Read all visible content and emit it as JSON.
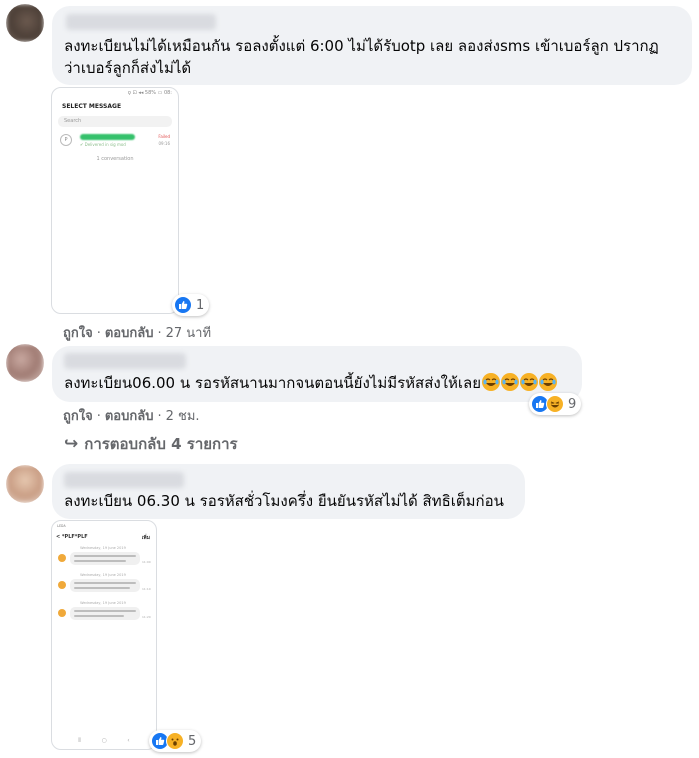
{
  "comments": [
    {
      "text_line1": "ลงทะเบียนไม่ได้เหมือนกัน รอลงตั้งแต่ 6:00 ไม่ได้รับotp เลย ลองส่งsms เข้าเบอร์ลูก ปรากฏ",
      "text_line2": "ว่าเบอร์ลูกก็ส่งไม่ได้",
      "screenshot": {
        "status_bar": "ǫ ⊡ ◂◂ 58% ▭ 08:",
        "title": "SELECT MESSAGE",
        "search_placeholder": "Search",
        "avatar_letter": "P",
        "failed_label": "Failed",
        "time": "09:16",
        "status_line": "✔ Delivered in sig mod",
        "conversation_count": "1 conversation"
      },
      "reactions": {
        "icons": [
          "like-icon"
        ],
        "count": "1"
      },
      "actions": {
        "like": "ถูกใจ",
        "reply": "ตอบกลับ",
        "time": "27 นาที"
      }
    },
    {
      "text": "ลงทะเบียน06.00 น รอรหัสนานมากจนตอนนี้ยังไม่มีรหัสส่งให้เลย",
      "emoji_count": 4,
      "reactions": {
        "icons": [
          "like-icon",
          "haha-icon"
        ],
        "count": "9"
      },
      "actions": {
        "like": "ถูกใจ",
        "reply": "ตอบกลับ",
        "time": "2 ชม."
      },
      "replies_label": "การตอบกลับ 4 รายการ"
    },
    {
      "text": "ลงทะเบียน 06.30 น รอรหัสชั่วโมงครึ่ง ยืนยันรหัสไม่ได้ สิทธิเต็มก่อน",
      "screenshot": {
        "status_bar": "ʟᴇᴅᴀ",
        "header": "< *PLF*PLF",
        "header_right": "เพิ่ม",
        "messages": [
          {
            "time": "Wednesday, 19 June 2019",
            "side_time": "11:00"
          },
          {
            "time": "Wednesday, 19 June 2019",
            "side_time": "11:10"
          },
          {
            "time": "Wednesday, 19 June 2019",
            "side_time": "11:20"
          }
        ],
        "nav": [
          "⦀",
          "○",
          "‹"
        ]
      },
      "reactions": {
        "icons": [
          "like-icon",
          "wow-icon"
        ],
        "count": "5"
      }
    }
  ],
  "colors": {
    "bubble": "#f0f2f5",
    "secondary_text": "#65676b",
    "like_blue": "#1877f2",
    "emoji_yellow": "#f7b125"
  }
}
